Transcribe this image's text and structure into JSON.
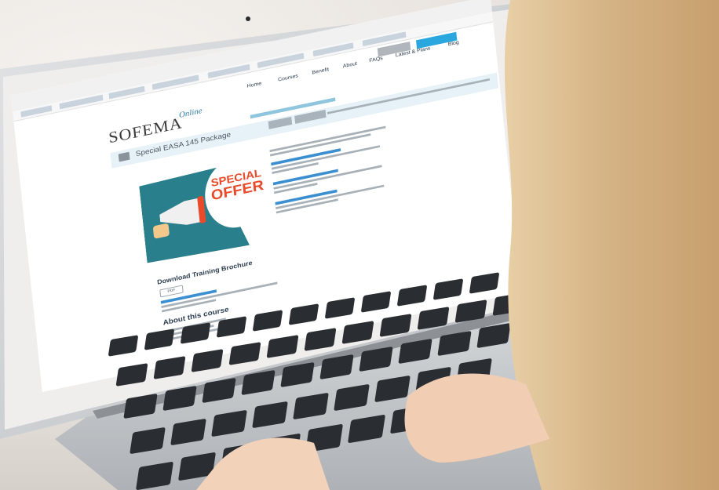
{
  "scene": {
    "colors": {
      "wall": "#ece8e4",
      "laptop_silver": "#cfd2d5",
      "bezel": "#ecebe9",
      "keys": "#2a2d31",
      "hair": "#d9b98a",
      "skin": "#f1cdb4",
      "accent_blue": "#2aa7df",
      "offer_teal": "#2a7f8c",
      "offer_red": "#e84a2a"
    }
  },
  "website": {
    "header": {
      "login_label": "",
      "register_label": "",
      "nav": [
        "Home",
        "Courses",
        "Benefit",
        "About",
        "FAQs",
        "Latest & Plans",
        "Blog"
      ]
    },
    "logo": {
      "text": "SOFEMA",
      "sub": "Online"
    },
    "page_title": "Special EASA 145 Package",
    "offer_graphic": {
      "line1": "SPECIAL",
      "line2": "OFFER"
    },
    "sections": {
      "brochure_heading": "Download Training Brochure",
      "pdf_label": "PDF",
      "about_heading": "About this course"
    }
  }
}
